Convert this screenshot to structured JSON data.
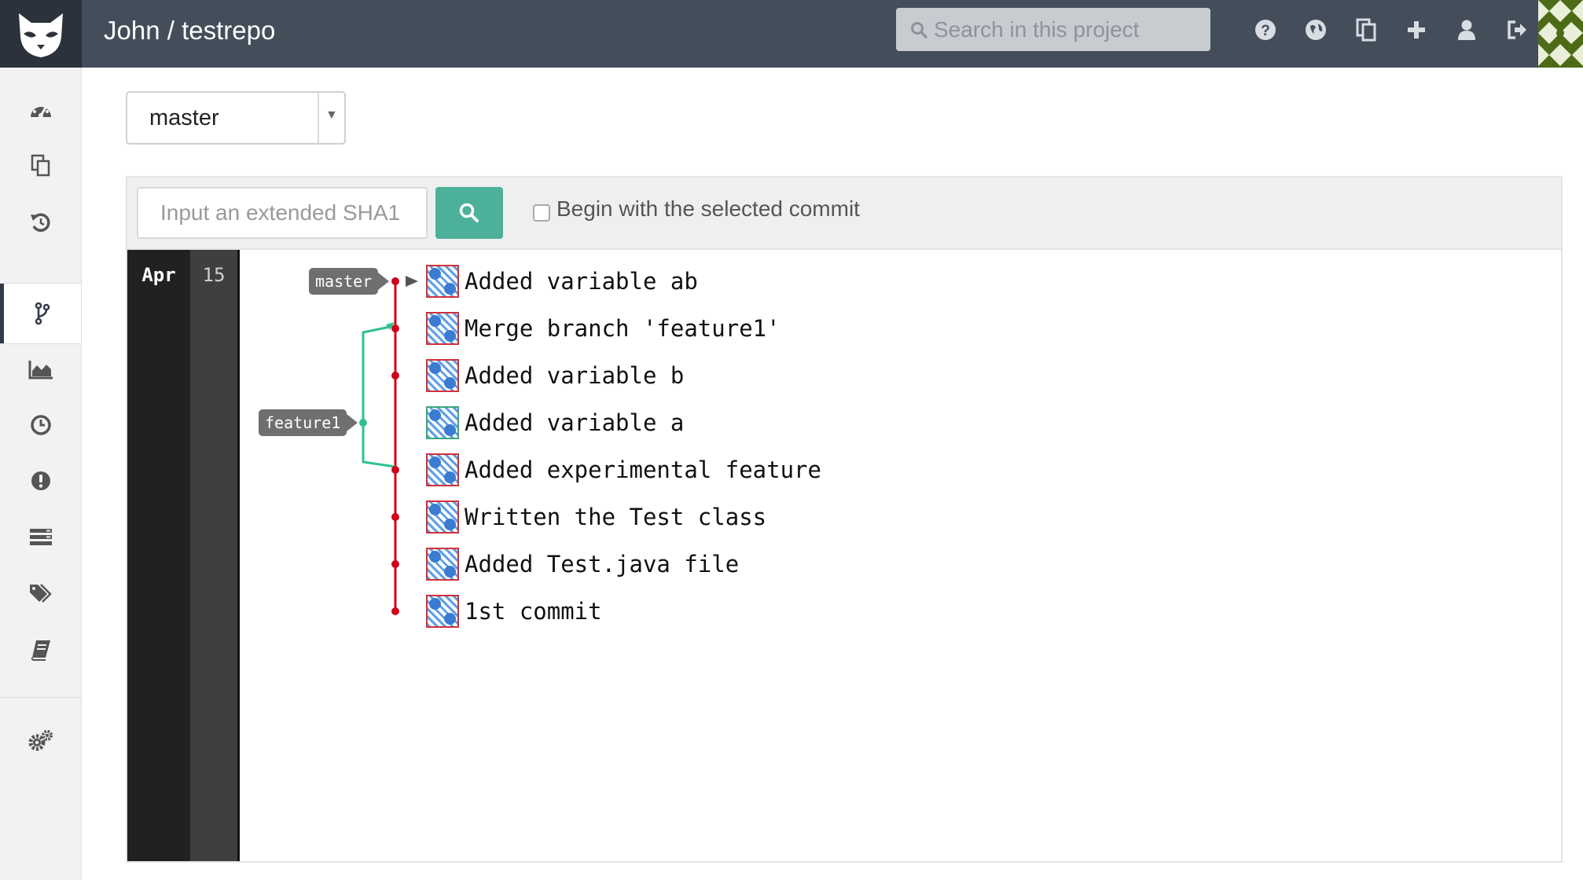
{
  "header": {
    "breadcrumb": "John / testrepo",
    "search_placeholder": "Search in this project",
    "icons": [
      "help-icon",
      "globe-icon",
      "snippets-icon",
      "plus-icon",
      "user-icon",
      "logout-icon"
    ]
  },
  "sidebar": {
    "items": [
      {
        "name": "dashboard-icon"
      },
      {
        "name": "files-icon"
      },
      {
        "name": "history-icon"
      },
      {
        "name": "network-icon",
        "active": true
      },
      {
        "name": "graphs-icon"
      },
      {
        "name": "milestones-icon"
      },
      {
        "name": "issues-icon"
      },
      {
        "name": "merge-requests-icon"
      },
      {
        "name": "tags-icon"
      },
      {
        "name": "wiki-icon"
      },
      {
        "name": "settings-icon"
      }
    ]
  },
  "branch_select": {
    "value": "master"
  },
  "filter": {
    "sha_placeholder": "Input an extended SHA1",
    "checkbox_label": "Begin with the selected commit",
    "checkbox_checked": false
  },
  "timeline": {
    "month": "Apr",
    "day": "15"
  },
  "refs": {
    "master": "master",
    "feature": "feature1"
  },
  "commits": [
    {
      "message": "Added variable ab"
    },
    {
      "message": "Merge branch 'feature1'"
    },
    {
      "message": "Added variable b"
    },
    {
      "message": "Added variable a"
    },
    {
      "message": "Added experimental feature"
    },
    {
      "message": "Written the Test class"
    },
    {
      "message": "Added Test.java file"
    },
    {
      "message": "1st commit"
    }
  ],
  "colors": {
    "topbar": "#444d5a",
    "main_branch": "#d0021b",
    "feature_branch": "#2dc28c",
    "search_button": "#4db09a"
  }
}
